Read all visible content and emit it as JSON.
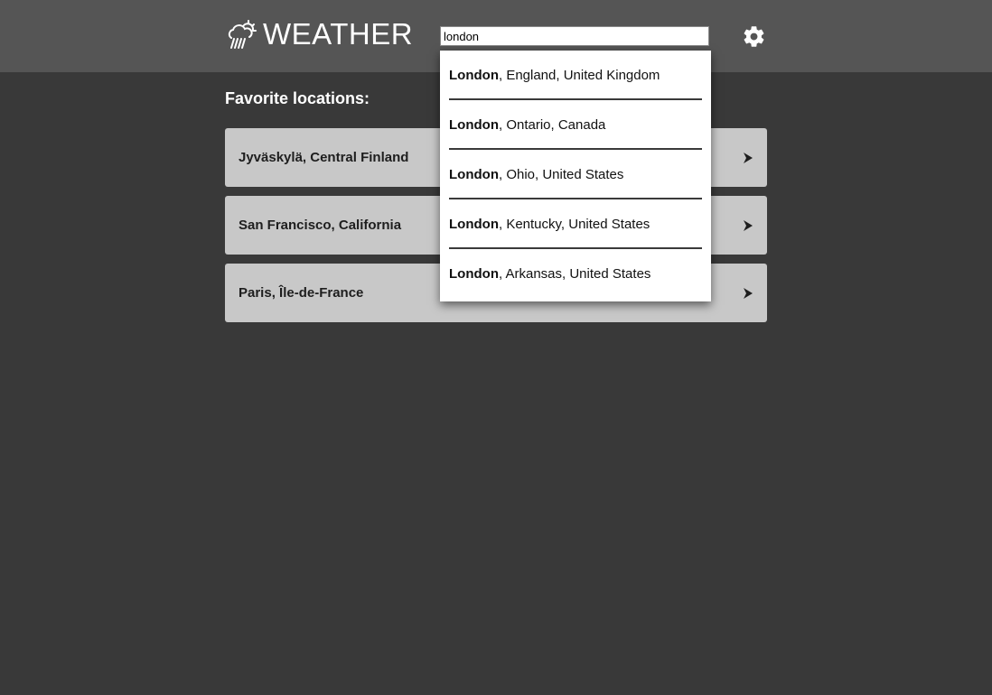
{
  "header": {
    "app_title": "WEATHER",
    "logo_icon": "cloud-rain-sun-icon",
    "settings_icon": "gear-icon"
  },
  "search": {
    "value": "london",
    "placeholder": ""
  },
  "favorites": {
    "heading": "Favorite locations:",
    "items": [
      {
        "label": "Jyväskylä, Central Finland"
      },
      {
        "label": "San Francisco, California"
      },
      {
        "label": "Paris, Île-de-France"
      }
    ],
    "arrow_icon": "chevron-right-icon"
  },
  "suggestions": [
    {
      "match": "London",
      "rest": ", England, United Kingdom"
    },
    {
      "match": "London",
      "rest": ", Ontario, Canada"
    },
    {
      "match": "London",
      "rest": ", Ohio, United States"
    },
    {
      "match": "London",
      "rest": ", Kentucky, United States"
    },
    {
      "match": "London",
      "rest": ", Arkansas, United States"
    }
  ],
  "colors": {
    "background": "#393939",
    "header": "#555555",
    "card": "#c8c8c8"
  }
}
